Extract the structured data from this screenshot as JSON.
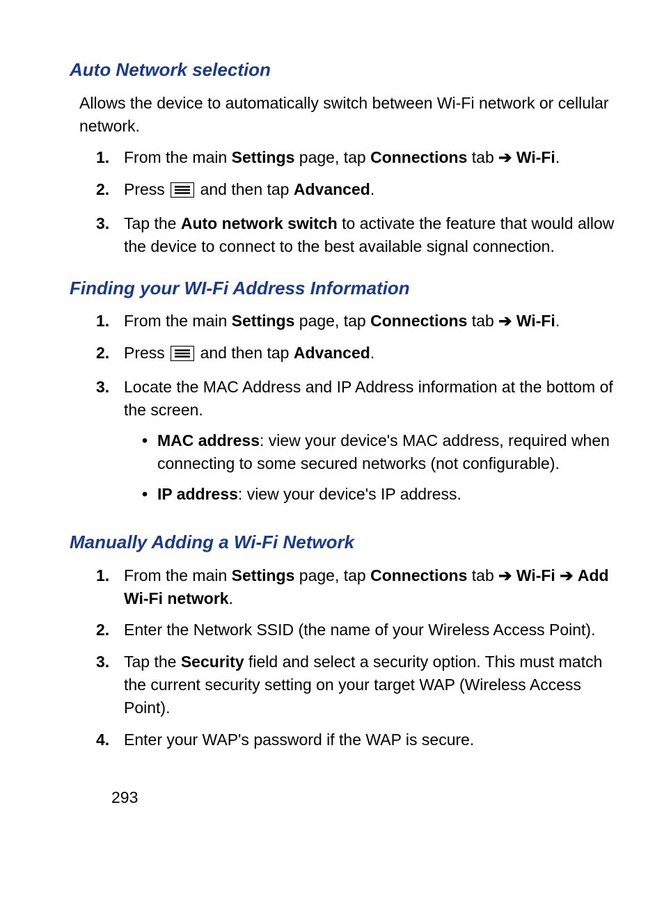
{
  "page_number": "293",
  "arrow": "➔",
  "sections": [
    {
      "title": "Auto Network selection",
      "intro": "Allows the device to automatically switch between Wi-Fi network or cellular network.",
      "steps": [
        {
          "num": "1.",
          "parts": [
            {
              "t": "From the main "
            },
            {
              "t": "Settings",
              "b": true
            },
            {
              "t": " page, tap "
            },
            {
              "t": "Connections",
              "b": true
            },
            {
              "t": " tab "
            },
            {
              "arrow": true
            },
            {
              "t": " "
            },
            {
              "t": "Wi-Fi",
              "b": true
            },
            {
              "t": "."
            }
          ]
        },
        {
          "num": "2.",
          "parts": [
            {
              "t": "Press "
            },
            {
              "icon": "menu"
            },
            {
              "t": " and then tap "
            },
            {
              "t": "Advanced",
              "b": true
            },
            {
              "t": "."
            }
          ]
        },
        {
          "num": "3.",
          "parts": [
            {
              "t": "Tap the "
            },
            {
              "t": "Auto network switch",
              "b": true
            },
            {
              "t": " to activate the feature that would allow the device to connect to the best available signal connection."
            }
          ]
        }
      ]
    },
    {
      "title": "Finding your WI-Fi Address Information",
      "steps": [
        {
          "num": "1.",
          "parts": [
            {
              "t": "From the main "
            },
            {
              "t": "Settings",
              "b": true
            },
            {
              "t": " page, tap "
            },
            {
              "t": "Connections",
              "b": true
            },
            {
              "t": " tab "
            },
            {
              "arrow": true
            },
            {
              "t": " "
            },
            {
              "t": "Wi-Fi",
              "b": true
            },
            {
              "t": "."
            }
          ]
        },
        {
          "num": "2.",
          "parts": [
            {
              "t": "Press "
            },
            {
              "icon": "menu"
            },
            {
              "t": " and then tap "
            },
            {
              "t": "Advanced",
              "b": true
            },
            {
              "t": "."
            }
          ]
        },
        {
          "num": "3.",
          "parts": [
            {
              "t": "Locate the MAC Address and IP Address information at the bottom of the screen."
            }
          ],
          "sub": [
            {
              "parts": [
                {
                  "t": "MAC address",
                  "b": true
                },
                {
                  "t": ": view your device's MAC address, required when connecting to some secured networks (not configurable)."
                }
              ]
            },
            {
              "parts": [
                {
                  "t": "IP address",
                  "b": true
                },
                {
                  "t": ": view your device's IP address."
                }
              ]
            }
          ]
        }
      ]
    },
    {
      "title": "Manually Adding a Wi-Fi Network",
      "steps": [
        {
          "num": "1.",
          "parts": [
            {
              "t": "From the main "
            },
            {
              "t": "Settings",
              "b": true
            },
            {
              "t": " page, tap "
            },
            {
              "t": "Connections",
              "b": true
            },
            {
              "t": " tab "
            },
            {
              "arrow": true
            },
            {
              "t": " "
            },
            {
              "t": "Wi-Fi",
              "b": true
            },
            {
              "t": " "
            },
            {
              "arrow": true
            },
            {
              "t": " "
            },
            {
              "t": "Add Wi-Fi network",
              "b": true
            },
            {
              "t": "."
            }
          ]
        },
        {
          "num": "2.",
          "parts": [
            {
              "t": "Enter the Network SSID (the name of your Wireless Access Point)."
            }
          ]
        },
        {
          "num": "3.",
          "parts": [
            {
              "t": "Tap the "
            },
            {
              "t": "Security",
              "b": true
            },
            {
              "t": " field and select a security option. This must match the current security setting on your target WAP (Wireless Access Point)."
            }
          ]
        },
        {
          "num": "4.",
          "parts": [
            {
              "t": "Enter your WAP's password if the WAP is secure."
            }
          ]
        }
      ]
    }
  ]
}
